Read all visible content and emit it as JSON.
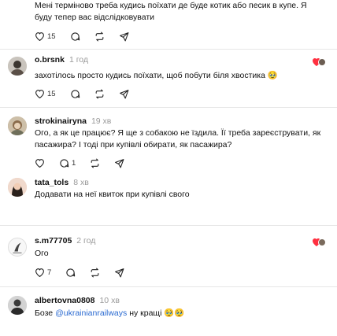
{
  "colors": {
    "link": "#2a6ad1",
    "time": "#9a9a9a",
    "heart": "#ff3040"
  },
  "posts": [
    {
      "text": "Мені терміново треба кудись поїхати де буде котик або песик в купе. Я буду тепер вас відслідковувати",
      "likes": "15"
    },
    {
      "username": "o.brsnk",
      "time": "1 год",
      "text": "захотілось просто кудись поїхати, щоб побути біля хвостика 🥹",
      "likes": "15"
    },
    {
      "username": "strokinairyna",
      "time": "19 хв",
      "text": "Ого, а як це працює? Я ще з собакою не їздила. Її треба зареєструвати, як пасажира? І тоді при купівлі обирати, як пасажира?",
      "replies": "1"
    },
    {
      "username": "tata_tols",
      "time": "8 хв",
      "text": "Додавати на неї квиток при купівлі свого"
    },
    {
      "username": "s.m77705",
      "time": "2 год",
      "text": "Ого",
      "likes": "7"
    },
    {
      "username": "albertovna0808",
      "time": "10 хв",
      "text_before": "Бозе ",
      "mention": "@ukrainianrailways",
      "text_after": " ну кращі 🥹🥹"
    }
  ]
}
